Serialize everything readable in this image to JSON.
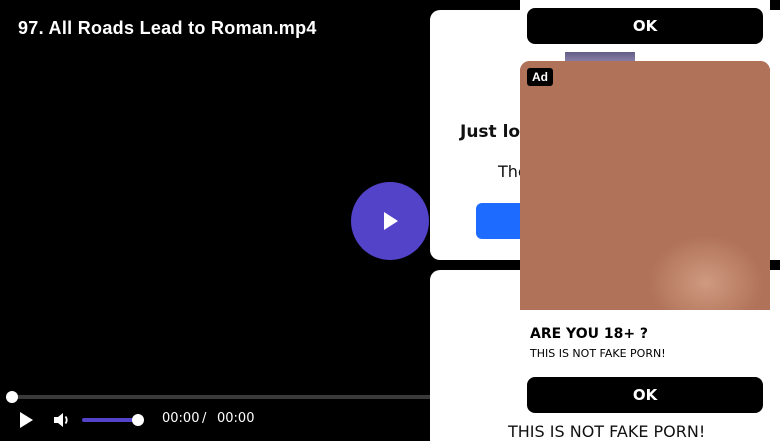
{
  "player": {
    "title": "97. All Roads Lead to Roman.mp4",
    "current_time": "00:00",
    "separator": "/",
    "duration": "00:00",
    "volume_fraction": 0.9,
    "progress_fraction": 0.0,
    "accent_color": "#5243c9"
  },
  "background_cards": {
    "card1_heading": "Just loc",
    "card1_text": "The",
    "card2_text": "THIS IS NOT FAKE PORN!"
  },
  "ad_top": {
    "ok_label": "OK"
  },
  "ad_main": {
    "badge": "Ad",
    "title": "ARE YOU 18+ ?",
    "description": "THIS IS NOT FAKE PORN!",
    "ok_label": "OK"
  },
  "icons": [
    "play-icon",
    "volume-icon",
    "big-play-icon"
  ]
}
